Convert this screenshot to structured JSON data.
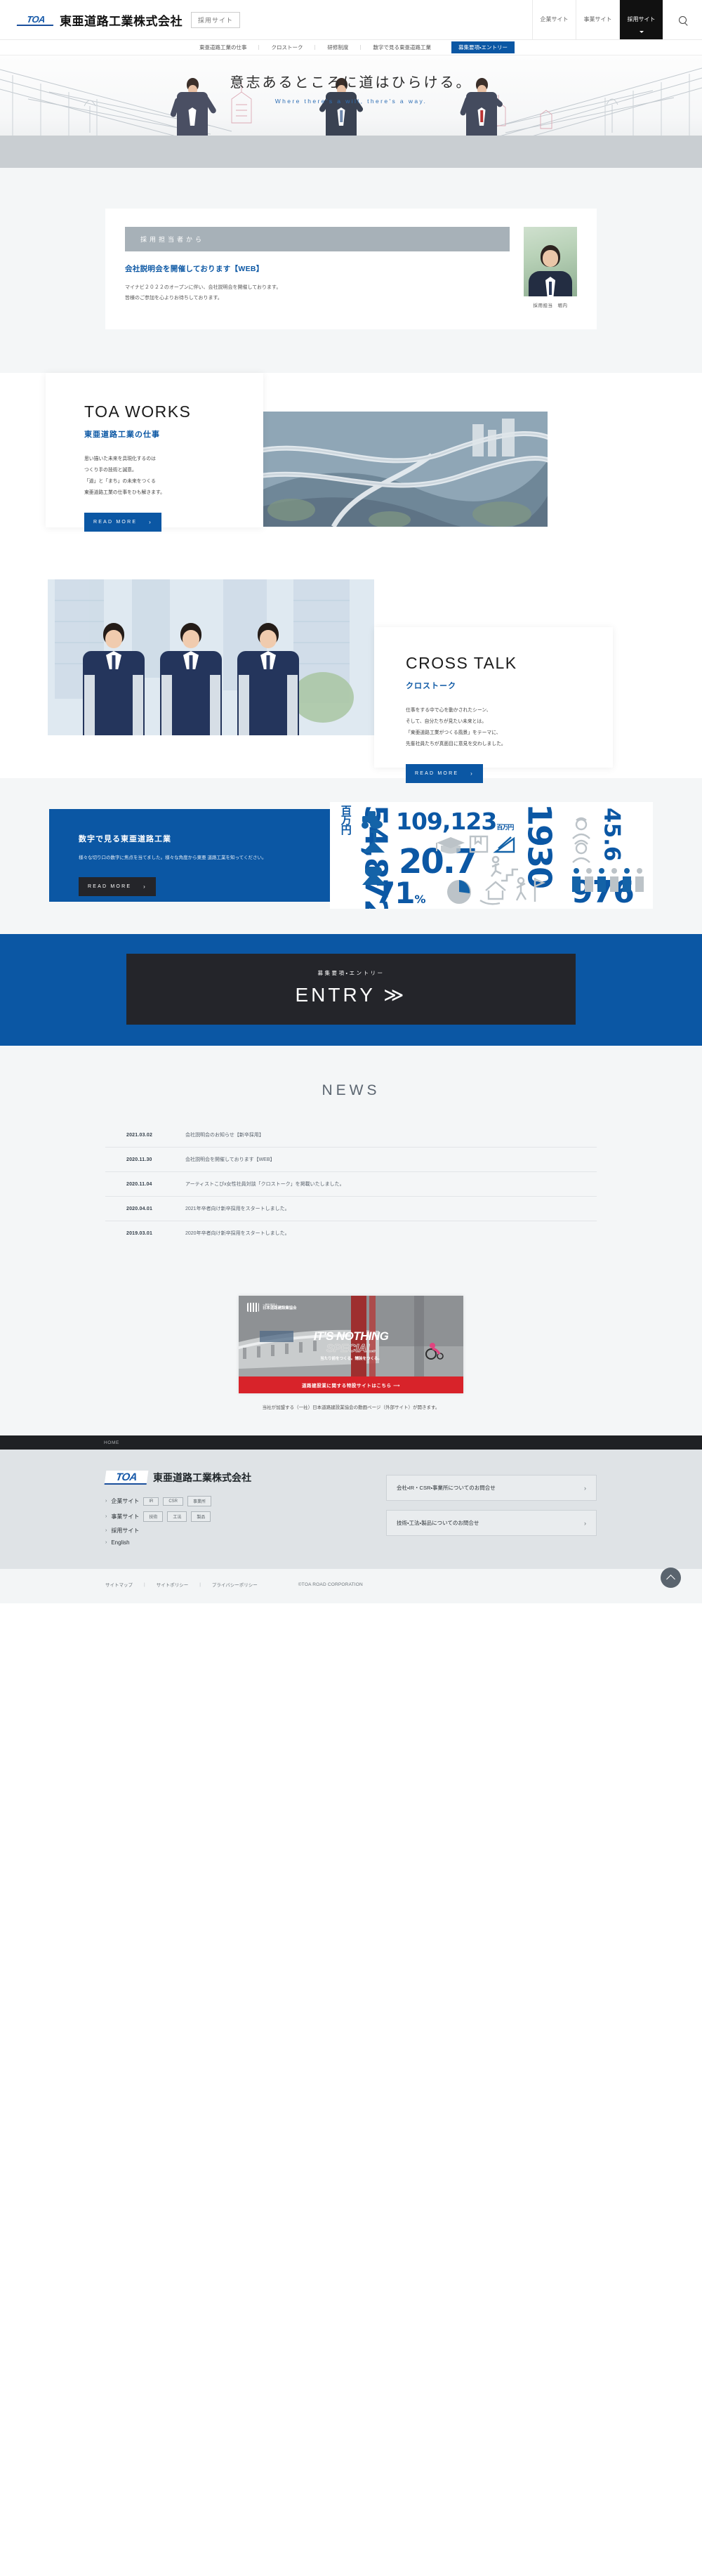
{
  "header": {
    "logo_mark": "TOA",
    "company_name": "東亜道路工業株式会社",
    "badge": "採用サイト",
    "nav": [
      {
        "label": "企業サイト",
        "active": false
      },
      {
        "label": "事業サイト",
        "active": false
      },
      {
        "label": "採用サイト",
        "active": true
      }
    ],
    "search_icon": "search-icon"
  },
  "subnav": {
    "items": [
      {
        "label": "東亜道路工業の仕事"
      },
      {
        "label": "クロストーク"
      },
      {
        "label": "研修制度"
      },
      {
        "label": "数字で見る東亜道路工業"
      }
    ],
    "cta": "募集要項・エントリー"
  },
  "hero": {
    "headline_jp": "意志あるところに道はひらける。",
    "headline_en": "Where there's a will, there's a way."
  },
  "recruiter": {
    "bar_label": "採用担当者から",
    "title": "会社説明会を開催しております【WEB】",
    "body_line1": "マイナビ２０２２のオープンに伴い、会社説明会を開催しております。",
    "body_line2": "皆様のご参加を心よりお待ちしております。",
    "photo_caption": "採用担当　堀内"
  },
  "works": {
    "title_en": "TOA WORKS",
    "title_jp": "東亜道路工業の仕事",
    "lead_line1": "思い描いた未来を具現化するのは",
    "lead_line2": "つくり手の技術と誠意。",
    "lead_line3": "「道」と「まち」の未来をつくる",
    "lead_line4": "東亜道路工業の仕事をひも解きます。",
    "button": "READ MORE",
    "chevron": "›"
  },
  "crosstalk": {
    "title_en": "CROSS TALK",
    "title_jp": "クロストーク",
    "lead_line1": "仕事をする中で心を動かされたシーン、",
    "lead_line2": "そして、自分たちが見たい未来とは。",
    "lead_line3": "「東亜道路工業がつくる風景」をテーマに、",
    "lead_line4": "先輩社員たちが真面目に意見を交わしました。",
    "button": "READ MORE",
    "chevron": "›"
  },
  "numbers": {
    "title": "数字で見る東亜道路工業",
    "body_line1": "様々な切り口の数字に焦点を当てました。様々な角度から東亜",
    "body_line2": "道路工業を知ってください。",
    "button": "READ MORE",
    "chevron": "›",
    "stats": [
      {
        "value": "54,872",
        "unit": "百万円",
        "orientation": "vertical"
      },
      {
        "value": "109,123",
        "unit": "百万円",
        "orientation": "horizontal"
      },
      {
        "value": "1930",
        "unit": "",
        "orientation": "vertical"
      },
      {
        "value": "45.6",
        "unit": "",
        "orientation": "vertical"
      },
      {
        "value": "20.7",
        "unit": "",
        "orientation": "horizontal"
      },
      {
        "value": "71",
        "unit": "%",
        "orientation": "horizontal"
      },
      {
        "value": "976",
        "unit": "",
        "orientation": "horizontal"
      }
    ],
    "icons": [
      "road-roller-icon",
      "shovel-icon",
      "asphalt-icon",
      "graduation-cap-icon",
      "book-icon",
      "ruler-pencil-icon",
      "stairs-person-icon",
      "worker-male-icon",
      "worker-female-icon",
      "people-group-icon",
      "pie-chart-icon",
      "house-hand-icon",
      "flag-climber-icon"
    ]
  },
  "entry": {
    "label_jp": "募集要項・エントリー",
    "label_en": "ENTRY",
    "arrow": "≫"
  },
  "news": {
    "title": "NEWS",
    "items": [
      {
        "date": "2021.03.02",
        "text": "会社説明会のお知らせ【新卒採用】"
      },
      {
        "date": "2020.11.30",
        "text": "会社説明会を開催しております【WEB】"
      },
      {
        "date": "2020.11.04",
        "text": "アーティストこぴx女性社員対談「クロストーク」を掲載いたしました。"
      },
      {
        "date": "2020.04.01",
        "text": "2021年卒者向け新卒採用をスタートしました。"
      },
      {
        "date": "2019.03.01",
        "text": "2020年卒者向け新卒採用をスタートしました。"
      }
    ]
  },
  "banner": {
    "org_small": "一般社団法人",
    "org_name": "日本道路建設業協会",
    "head_line1": "IT'S NOTHING",
    "head_line2": "SPECIAL.",
    "sub": "当たり前をつくる。舗装をつくる。",
    "bar_text": "道路建設業に関する特設サイトはこちら ⟶",
    "caption": "当社が加盟する（一社）日本道路建設業協会の動画ページ（外部サイト）が開きます。"
  },
  "breadcrumb": {
    "home": "HOME"
  },
  "footer": {
    "logo_mark": "TOA",
    "company_name": "東亜道路工業株式会社",
    "links": [
      {
        "label": "企業サイト",
        "tags": [
          "IR",
          "CSR",
          "事業所"
        ]
      },
      {
        "label": "事業サイト",
        "tags": [
          "技術",
          "工法",
          "製品"
        ]
      },
      {
        "label": "採用サイト",
        "tags": []
      },
      {
        "label": "English",
        "tags": []
      }
    ],
    "arrow": "›",
    "buttons": [
      {
        "label": "会社・IR・CSR・事業所についてのお問合せ",
        "chevron": "›"
      },
      {
        "label": "技術・工法・製品についてのお問合せ",
        "chevron": "›"
      }
    ]
  },
  "bottom": {
    "links": [
      "サイトマップ",
      "サイトポリシー",
      "プライバシーポリシー"
    ],
    "separator": "|",
    "copyright": "©TOA ROAD CORPORATION",
    "totop_icon": "chevron-up-icon"
  }
}
